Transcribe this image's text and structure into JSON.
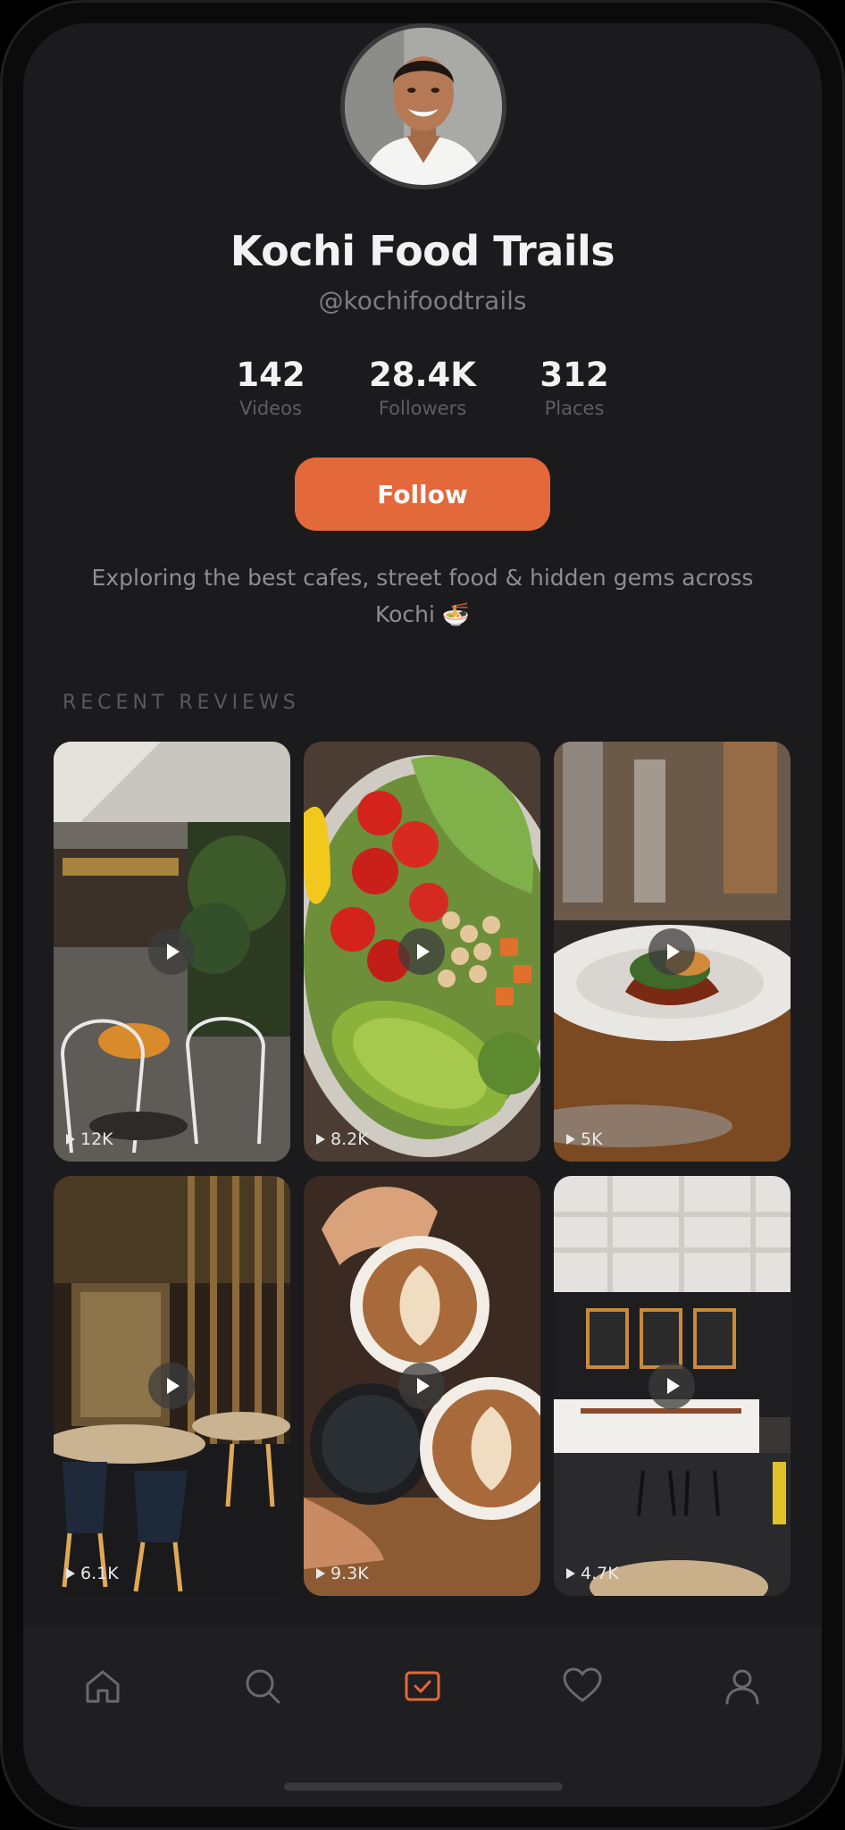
{
  "profile": {
    "name": "Kochi Food Trails",
    "handle": "@kochifoodtrails",
    "bio": "Exploring the best cafes, street food & hidden gems across Kochi 🍜"
  },
  "stats": [
    {
      "value": "142",
      "label": "Videos"
    },
    {
      "value": "28.4K",
      "label": "Followers"
    },
    {
      "value": "312",
      "label": "Places"
    }
  ],
  "follow_label": "Follow",
  "section_title": "RECENT REVIEWS",
  "reviews": [
    {
      "views": "12K",
      "subject": "cafe interior"
    },
    {
      "views": "8.2K",
      "subject": "salad bowl"
    },
    {
      "views": "5K",
      "subject": "plated dish"
    },
    {
      "views": "6.1K",
      "subject": "restaurant dining hall"
    },
    {
      "views": "9.3K",
      "subject": "coffee cups"
    },
    {
      "views": "4.7K",
      "subject": "cafe counter"
    }
  ],
  "tabs": [
    {
      "icon": "home-icon"
    },
    {
      "icon": "search-icon"
    },
    {
      "icon": "checkbox-icon",
      "active": true
    },
    {
      "icon": "heart-icon"
    },
    {
      "icon": "profile-icon"
    }
  ],
  "colors": {
    "accent": "#e3683a",
    "background": "#1b1b1d",
    "tab_inactive": "#6a6a6d"
  }
}
